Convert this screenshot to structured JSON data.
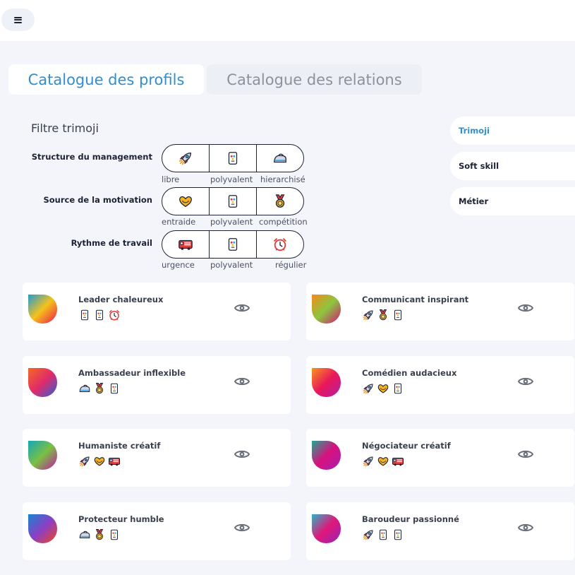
{
  "header": {
    "menu_icon": "hamburger-icon"
  },
  "tabs": [
    {
      "label": "Catalogue des profils",
      "active": true
    },
    {
      "label": "Catalogue des relations",
      "active": false
    }
  ],
  "filter": {
    "title": "Filtre trimoji",
    "rows": [
      {
        "label": "Structure du management",
        "options": [
          {
            "label": "libre",
            "icon": "rocket-icon"
          },
          {
            "label": "polyvalent",
            "icon": "card-icon"
          },
          {
            "label": "hierarchisé",
            "icon": "iron-icon"
          }
        ]
      },
      {
        "label": "Source de la motivation",
        "options": [
          {
            "label": "entraide",
            "icon": "heart-hands-icon"
          },
          {
            "label": "polyvalent",
            "icon": "card-icon"
          },
          {
            "label": "compétition",
            "icon": "medal-icon"
          }
        ]
      },
      {
        "label": "Rythme de travail",
        "options": [
          {
            "label": "urgence",
            "icon": "fire-truck-icon"
          },
          {
            "label": "polyvalent",
            "icon": "card-icon"
          },
          {
            "label": "régulier",
            "icon": "alarm-clock-icon"
          }
        ]
      }
    ]
  },
  "side_tabs": [
    {
      "label": "Trimoji",
      "active": true
    },
    {
      "label": "Soft skill",
      "active": false
    },
    {
      "label": "Métier",
      "active": false
    }
  ],
  "profiles": [
    {
      "name": "Leader chaleureux",
      "icons": [
        "card-icon",
        "card-icon",
        "alarm-clock-icon"
      ],
      "colors": [
        "#1f9ad6",
        "#f6c21a",
        "#e8184f"
      ]
    },
    {
      "name": "Communicant inspirant",
      "icons": [
        "rocket-icon",
        "medal-icon",
        "card-icon"
      ],
      "colors": [
        "#f58a1f",
        "#8cc63e",
        "#d6107a"
      ]
    },
    {
      "name": "Ambassadeur inflexible",
      "icons": [
        "iron-icon",
        "medal-icon",
        "card-icon"
      ],
      "colors": [
        "#f26a21",
        "#e22a6a",
        "#2b5fd6"
      ]
    },
    {
      "name": "Comédien audacieux",
      "icons": [
        "rocket-icon",
        "heart-hands-icon",
        "card-icon"
      ],
      "colors": [
        "#f7941d",
        "#e8185a",
        "#b31fa3"
      ]
    },
    {
      "name": "Humaniste créatif",
      "icons": [
        "rocket-icon",
        "heart-hands-icon",
        "fire-truck-icon"
      ],
      "colors": [
        "#14a7b8",
        "#7bc043",
        "#c317a6"
      ]
    },
    {
      "name": "Négociateur créatif",
      "icons": [
        "rocket-icon",
        "heart-hands-icon",
        "fire-truck-icon"
      ],
      "colors": [
        "#1fa88f",
        "#d8107e",
        "#a322b0"
      ]
    },
    {
      "name": "Protecteur humble",
      "icons": [
        "iron-icon",
        "medal-icon",
        "card-icon"
      ],
      "colors": [
        "#1585cf",
        "#8b3fc4",
        "#f2451f"
      ]
    },
    {
      "name": "Baroudeur passionné",
      "icons": [
        "rocket-icon",
        "card-icon",
        "card-icon"
      ],
      "colors": [
        "#2bb6c4",
        "#e0177a",
        "#9424b8"
      ]
    }
  ]
}
